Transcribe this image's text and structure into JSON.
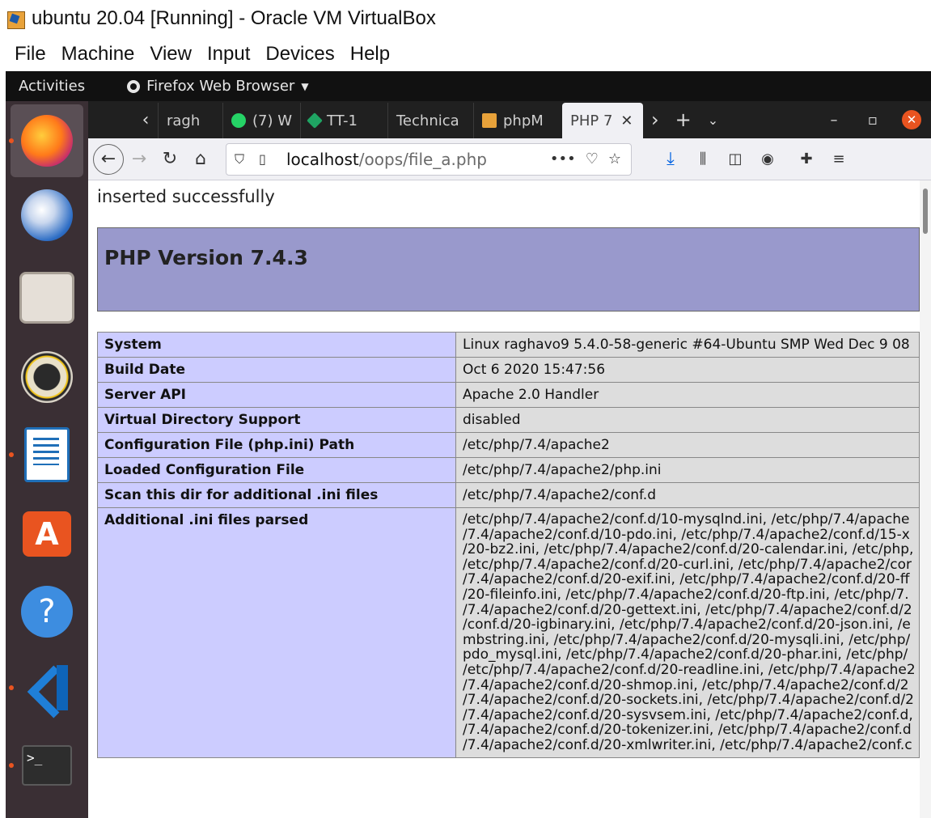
{
  "vbox": {
    "title": "ubuntu 20.04  [Running] - Oracle VM VirtualBox",
    "menu": [
      "File",
      "Machine",
      "View",
      "Input",
      "Devices",
      "Help"
    ]
  },
  "gnome": {
    "activities": "Activities",
    "app_menu": "Firefox Web Browser"
  },
  "dock": {
    "items": [
      "firefox",
      "thunderbird",
      "files",
      "rhythmbox",
      "libreoffice-writer",
      "ubuntu-software",
      "help",
      "vscode",
      "terminal"
    ],
    "terminal_glyph": ">_"
  },
  "browser": {
    "tabs": [
      {
        "label": "ragh",
        "favicon_color": "#4a4a4a"
      },
      {
        "label": "(7) W",
        "favicon_color": "#25d366"
      },
      {
        "label": "TT-1",
        "favicon_color": "#1fa463"
      },
      {
        "label": "Technica",
        "favicon_color": ""
      },
      {
        "label": "phpM",
        "favicon_color": "#e8a23a"
      },
      {
        "label": "PHP 7",
        "favicon_color": ""
      }
    ],
    "url_host": "localhost",
    "url_path": "/oops/file_a.php",
    "url_more": "•••"
  },
  "page": {
    "message": "inserted successfully",
    "php_version": "PHP Version 7.4.3",
    "colors": {
      "header_bg": "#9999cc",
      "key_bg": "#ccccff",
      "value_bg": "#dddddd"
    },
    "rows": [
      {
        "key": "System",
        "value": "Linux raghavo9 5.4.0-58-generic #64-Ubuntu SMP Wed Dec 9 08"
      },
      {
        "key": "Build Date",
        "value": "Oct 6 2020 15:47:56"
      },
      {
        "key": "Server API",
        "value": "Apache 2.0 Handler"
      },
      {
        "key": "Virtual Directory Support",
        "value": "disabled"
      },
      {
        "key": "Configuration File (php.ini) Path",
        "value": "/etc/php/7.4/apache2"
      },
      {
        "key": "Loaded Configuration File",
        "value": "/etc/php/7.4/apache2/php.ini"
      },
      {
        "key": "Scan this dir for additional .ini files",
        "value": "/etc/php/7.4/apache2/conf.d"
      }
    ],
    "ini_key": "Additional .ini files parsed",
    "ini_lines": [
      "/etc/php/7.4/apache2/conf.d/10-mysqlnd.ini, /etc/php/7.4/apache",
      "/7.4/apache2/conf.d/10-pdo.ini, /etc/php/7.4/apache2/conf.d/15-x",
      "/20-bz2.ini, /etc/php/7.4/apache2/conf.d/20-calendar.ini, /etc/php,",
      "/etc/php/7.4/apache2/conf.d/20-curl.ini, /etc/php/7.4/apache2/cor",
      "/7.4/apache2/conf.d/20-exif.ini, /etc/php/7.4/apache2/conf.d/20-ff",
      "/20-fileinfo.ini, /etc/php/7.4/apache2/conf.d/20-ftp.ini, /etc/php/7.",
      "/7.4/apache2/conf.d/20-gettext.ini, /etc/php/7.4/apache2/conf.d/2",
      "/conf.d/20-igbinary.ini, /etc/php/7.4/apache2/conf.d/20-json.ini, /e",
      "mbstring.ini, /etc/php/7.4/apache2/conf.d/20-mysqli.ini, /etc/php/",
      "pdo_mysql.ini, /etc/php/7.4/apache2/conf.d/20-phar.ini, /etc/php/",
      "/etc/php/7.4/apache2/conf.d/20-readline.ini, /etc/php/7.4/apache2",
      "/7.4/apache2/conf.d/20-shmop.ini, /etc/php/7.4/apache2/conf.d/2",
      "/7.4/apache2/conf.d/20-sockets.ini, /etc/php/7.4/apache2/conf.d/2",
      "/7.4/apache2/conf.d/20-sysvsem.ini, /etc/php/7.4/apache2/conf.d,",
      "/7.4/apache2/conf.d/20-tokenizer.ini, /etc/php/7.4/apache2/conf.d",
      "/7.4/apache2/conf.d/20-xmlwriter.ini, /etc/php/7.4/apache2/conf.c"
    ]
  }
}
